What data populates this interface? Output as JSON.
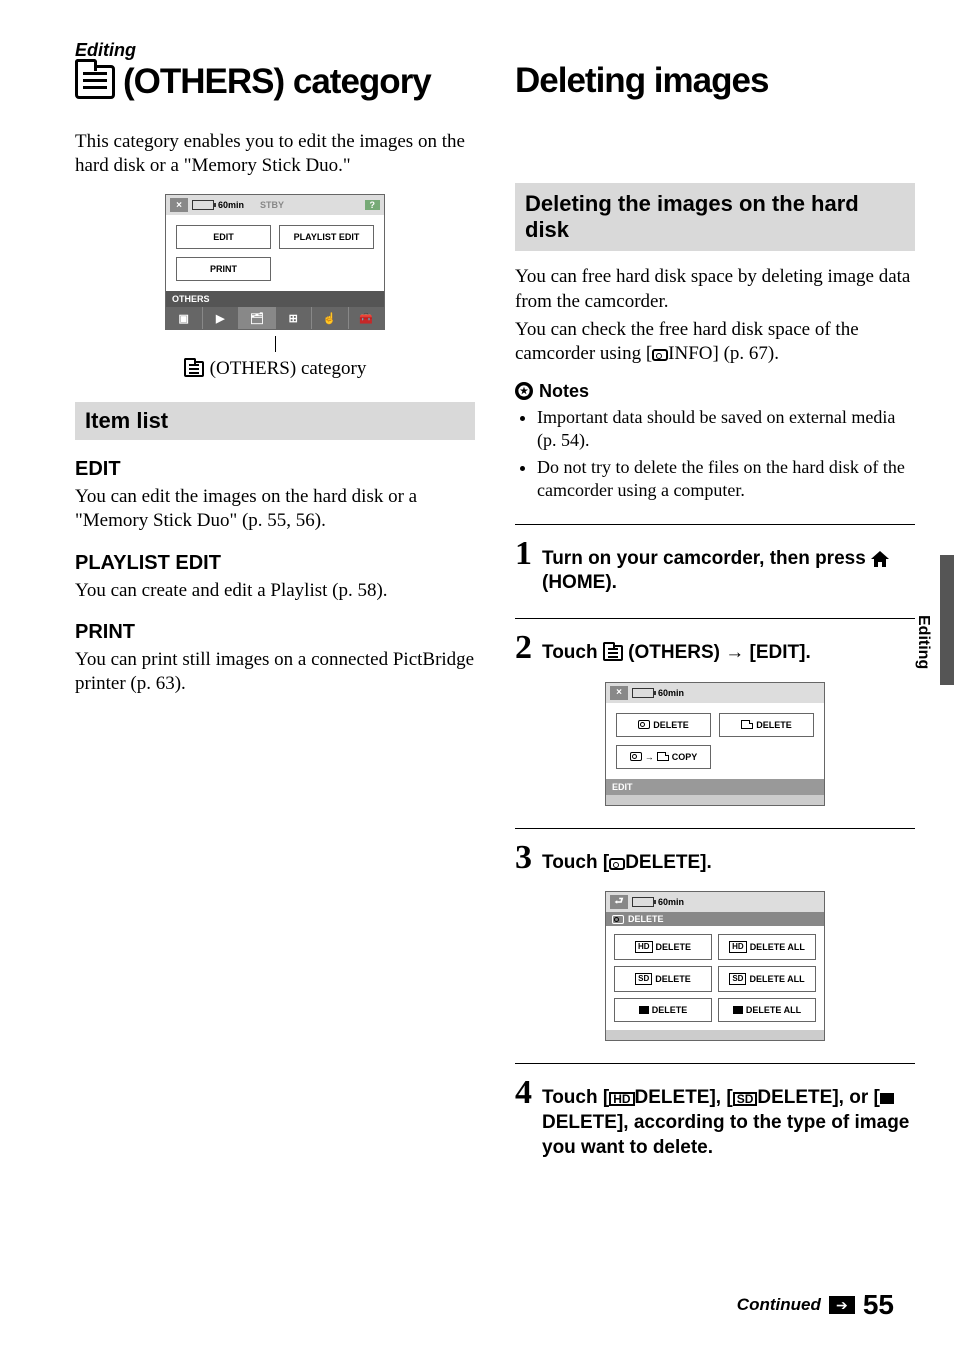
{
  "left": {
    "kicker": "Editing",
    "title": "(OTHERS) category",
    "intro": "This category enables you to edit the images on the hard disk or a \"Memory Stick Duo.\"",
    "ui1": {
      "battery": "60min",
      "stby": "STBY",
      "help": "?",
      "edit": "EDIT",
      "playlist_edit": "PLAYLIST EDIT",
      "print": "PRINT",
      "footer_title": "OTHERS"
    },
    "ui1_caption": "(OTHERS) category",
    "itemlist_title": "Item list",
    "edit": {
      "h": "EDIT",
      "p": "You can edit the images on the hard disk or a \"Memory Stick Duo\" (p. 55, 56)."
    },
    "playlist": {
      "h": "PLAYLIST EDIT",
      "p": "You can create and edit a Playlist (p. 58)."
    },
    "print": {
      "h": "PRINT",
      "p": "You can print still images on a connected PictBridge printer (p. 63)."
    }
  },
  "right": {
    "title": "Deleting images",
    "sub_title": "Deleting the images on the hard disk",
    "p1": "You can free hard disk space by deleting image data from the camcorder.",
    "p2a": "You can check the free hard disk space of the camcorder using [",
    "p2b": "INFO] (p. 67).",
    "notes_label": "Notes",
    "notes": [
      "Important data should be saved on external media (p. 54).",
      "Do not try to delete the files on the hard disk of the camcorder using a computer."
    ],
    "step1a": "Turn on your camcorder, then press ",
    "step1b": "(HOME).",
    "step2a": "Touch ",
    "step2b": "(OTHERS) → [EDIT].",
    "ui2": {
      "battery": "60min",
      "hdd_delete": "DELETE",
      "ms_delete": "DELETE",
      "copy": "COPY",
      "footer": "EDIT"
    },
    "step3a": "Touch [",
    "step3b": "DELETE].",
    "ui3": {
      "battery": "60min",
      "title": "DELETE",
      "hd_delete": "DELETE",
      "hd_delete_all": "DELETE ALL",
      "sd_delete": "DELETE",
      "sd_delete_all": "DELETE ALL",
      "img_delete": "DELETE",
      "img_delete_all": "DELETE ALL"
    },
    "step4a": "Touch [",
    "step4b": "DELETE], [",
    "step4c": "DELETE], or [",
    "step4d": "DELETE], according to the type of image you want to delete."
  },
  "side_label": "Editing",
  "continued": "Continued",
  "page": "55"
}
